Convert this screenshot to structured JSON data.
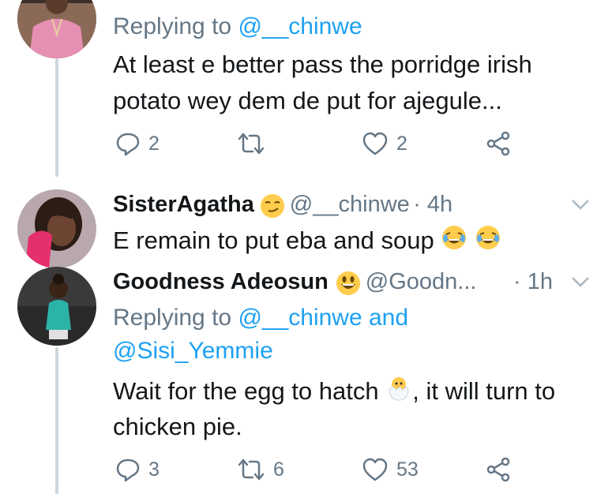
{
  "tweets": [
    {
      "reply_prefix": "Replying to ",
      "reply_to": "@__chinwe",
      "text_line1": "At least e better pass the porridge irish",
      "text_line2": "potato wey dem de put for ajegule...",
      "replies": "2",
      "retweets": "",
      "likes": "2"
    },
    {
      "name": "SisterAgatha",
      "handle": "@__chinwe",
      "time": "· 4h",
      "text": "E remain to put eba and soup"
    },
    {
      "name": "Goodness Adeosun",
      "handle": "@Goodn...",
      "time": "· 1h",
      "reply_prefix": "Replying to ",
      "reply_to_line1": "@__chinwe and",
      "reply_to_line2": "@Sisi_Yemmie",
      "text_line1_a": "Wait for the egg to hatch",
      "text_line1_b": ", it will turn to",
      "text_line2": "chicken pie.",
      "replies": "3",
      "retweets": "6",
      "likes": "53"
    }
  ],
  "colors": {
    "link": "#1da1f2",
    "secondary": "#657786",
    "thread_line": "#ccd6dd"
  },
  "icons": [
    "reply-icon",
    "retweet-icon",
    "like-icon",
    "share-icon",
    "chevron-down-icon",
    "smirk-emoji",
    "laughing-emoji",
    "grinning-emoji",
    "hatching-chick-emoji"
  ]
}
